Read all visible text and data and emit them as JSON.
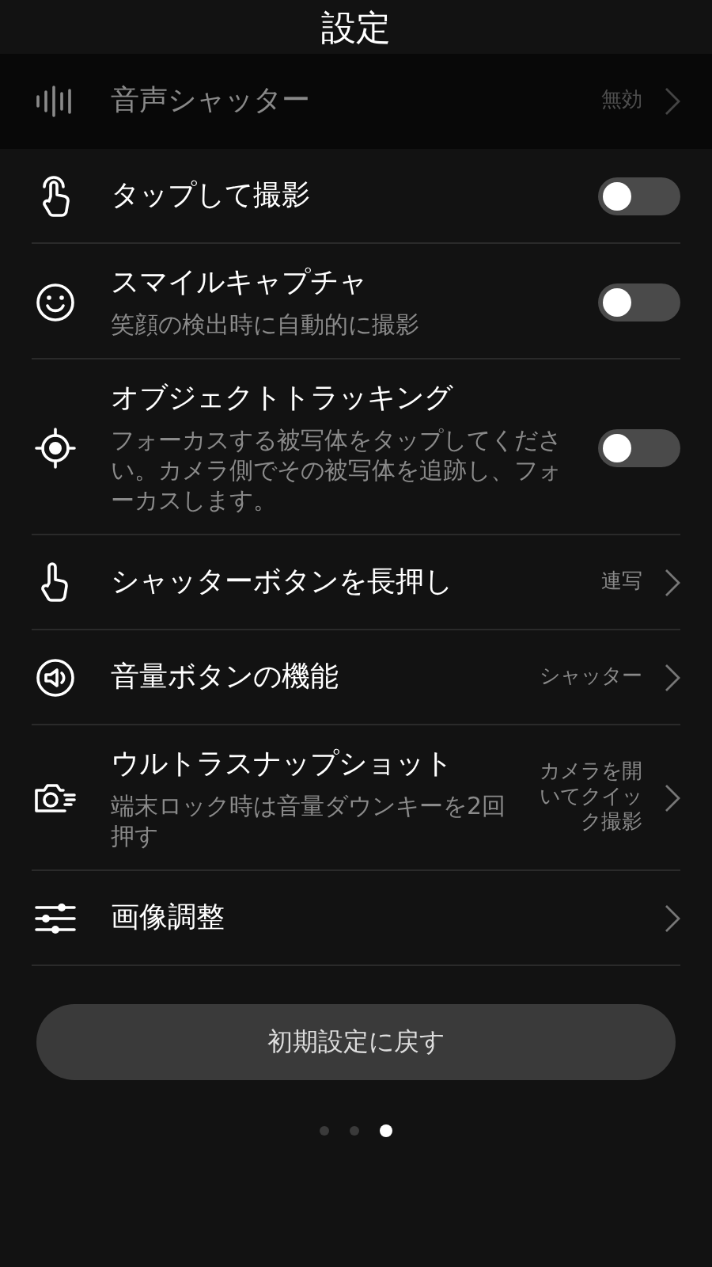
{
  "title": "設定",
  "items": [
    {
      "kind": "link",
      "label": "音声シャッター",
      "value": "無効",
      "disabled": true
    },
    {
      "kind": "toggle",
      "label": "タップして撮影",
      "on": false,
      "disabled": false
    },
    {
      "kind": "toggle",
      "label": "スマイルキャプチャ",
      "description": "笑顔の検出時に自動的に撮影",
      "on": false,
      "disabled": false
    },
    {
      "kind": "toggle",
      "label": "オブジェクトトラッキング",
      "description": "フォーカスする被写体をタップしてください。カメラ側でその被写体を追跡し、フォーカスします。",
      "on": false,
      "disabled": false
    },
    {
      "kind": "link",
      "label": "シャッターボタンを長押し",
      "value": "連写",
      "disabled": false
    },
    {
      "kind": "link",
      "label": "音量ボタンの機能",
      "value": "シャッター",
      "disabled": false
    },
    {
      "kind": "link",
      "label": "ウルトラスナップショット",
      "description": "端末ロック時は音量ダウンキーを2回押す",
      "value": "カメラを開いてクイック撮影",
      "disabled": false
    },
    {
      "kind": "link",
      "label": "画像調整",
      "disabled": false
    }
  ],
  "reset_button": "初期設定に戻す",
  "page_dots": [
    {
      "selected": false
    },
    {
      "selected": false
    },
    {
      "selected": true
    }
  ]
}
